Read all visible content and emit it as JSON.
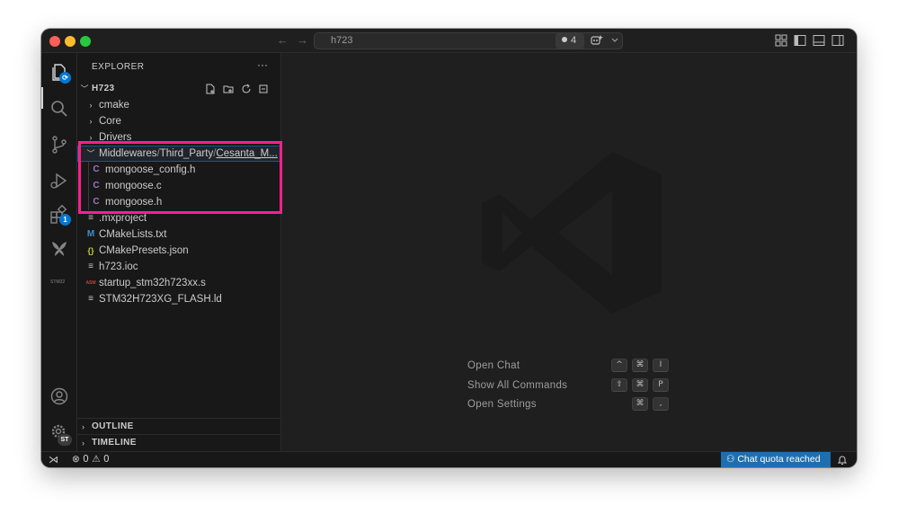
{
  "titlebar": {
    "search_text": "h723",
    "badge_count": "4",
    "back_icon": "arrow-left",
    "forward_icon": "arrow-right"
  },
  "activity": {
    "extensions_badge": "1",
    "account_badge": "ST",
    "stm32_label": "STM32"
  },
  "sidebar": {
    "title": "EXPLORER",
    "more": "···",
    "root": "H723",
    "folders": [
      {
        "label": "cmake"
      },
      {
        "label": "Core"
      },
      {
        "label": "Drivers"
      }
    ],
    "breadcrumb": {
      "part1": "Middlewares",
      "sep": "/",
      "part2": "Third_Party",
      "part3": "Cesanta_M..."
    },
    "mongoose_files": [
      {
        "icon": "C",
        "label": "mongoose_config.h"
      },
      {
        "icon": "C",
        "label": "mongoose.c"
      },
      {
        "icon": "C",
        "label": "mongoose.h"
      }
    ],
    "root_files": [
      {
        "icon": "≡",
        "label": ".mxproject",
        "color": "#c5c5c5"
      },
      {
        "icon": "M",
        "label": "CMakeLists.txt",
        "color": "#3b8fd1"
      },
      {
        "icon": "{}",
        "label": "CMakePresets.json",
        "color": "#cbcb41"
      },
      {
        "icon": "≡",
        "label": "h723.ioc",
        "color": "#c5c5c5"
      },
      {
        "icon": "ASM",
        "label": "startup_stm32h723xx.s",
        "color": "#d13b3b"
      },
      {
        "icon": "≡",
        "label": "STM32H723XG_FLASH.ld",
        "color": "#c5c5c5"
      }
    ],
    "outline": "OUTLINE",
    "timeline": "TIMELINE"
  },
  "editor": {
    "commands": [
      {
        "label": "Open Chat",
        "keys": [
          "^",
          "⌘",
          "I"
        ]
      },
      {
        "label": "Show All Commands",
        "keys": [
          "⇧",
          "⌘",
          "P"
        ]
      },
      {
        "label": "Open Settings",
        "keys": [
          "⌘",
          ","
        ]
      }
    ]
  },
  "statusbar": {
    "errors": "0",
    "warnings": "0",
    "chat_quota": "Chat quota reached"
  },
  "colors": {
    "highlight": "#ff1f8e",
    "c_file_icon": "#a074c4",
    "accent": "#0078d4"
  }
}
